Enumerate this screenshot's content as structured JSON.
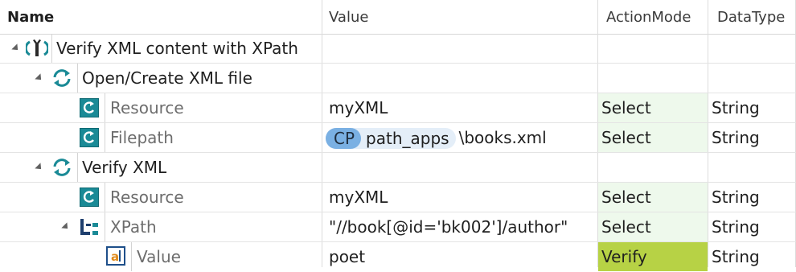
{
  "columns": {
    "name": "Name",
    "value": "Value",
    "action_mode": "ActionMode",
    "data_type": "DataType"
  },
  "colors": {
    "select_bg": "#eef9ec",
    "verify_bg": "#b7d245",
    "chip_cp_bg": "#7ab0e3",
    "chip_bg": "#e4eef8",
    "icon_teal": "#1a8a96"
  },
  "rows": [
    {
      "name": "Verify XML content with XPath",
      "value": "",
      "action_mode": "",
      "data_type": "",
      "icon": "wrench-gear-icon"
    },
    {
      "name": "Open/Create XML file",
      "value": "",
      "action_mode": "",
      "data_type": "",
      "icon": "refresh-icon"
    },
    {
      "name": "Resource",
      "value": "myXML",
      "action_mode": "Select",
      "data_type": "String",
      "icon": "refresh-box-icon"
    },
    {
      "name": "Filepath",
      "value_chip_tag": "CP",
      "value_chip_name": "path_apps",
      "value_suffix": "\\books.xml",
      "action_mode": "Select",
      "data_type": "String",
      "icon": "refresh-box-icon"
    },
    {
      "name": "Verify XML",
      "value": "",
      "action_mode": "",
      "data_type": "",
      "icon": "refresh-icon"
    },
    {
      "name": "Resource",
      "value": "myXML",
      "action_mode": "Select",
      "data_type": "String",
      "icon": "refresh-box-icon"
    },
    {
      "name": "XPath",
      "value": "\"//book[@id='bk002']/author\"",
      "action_mode": "Select",
      "data_type": "String",
      "icon": "xpath-tree-icon"
    },
    {
      "name": "Value",
      "value": "poet",
      "action_mode": "Verify",
      "data_type": "String",
      "icon": "attribute-icon"
    }
  ]
}
